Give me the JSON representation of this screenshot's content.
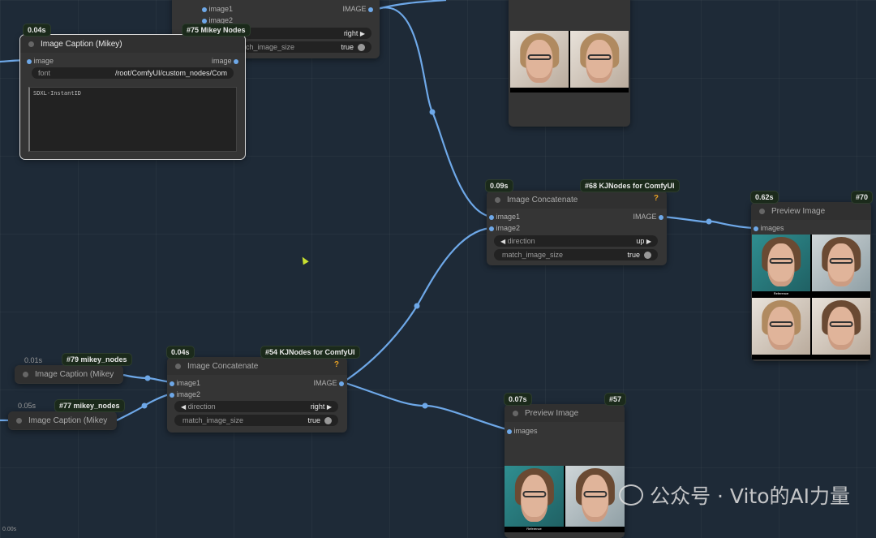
{
  "node_top": {
    "inputs": [
      "image1",
      "image2"
    ],
    "output": "IMAGE",
    "direction_value": "right",
    "match_label": "match_image_size",
    "match_value": "true"
  },
  "node_caption75": {
    "time": "0.04s",
    "badge": "#75 Mikey Nodes",
    "title": "Image Caption (Mikey)",
    "input": "image",
    "output": "image",
    "font_label": "font",
    "font_value": "/root/ComfyUI/custom_nodes/Com",
    "caption_text": "SDXL-InstantID"
  },
  "node_concat68": {
    "time": "0.09s",
    "badge": "#68 KJNodes for ComfyUI",
    "title": "Image Concatenate",
    "help": "?",
    "inputs": [
      "image1",
      "image2"
    ],
    "output": "IMAGE",
    "direction_label": "direction",
    "direction_value": "up",
    "match_label": "match_image_size",
    "match_value": "true"
  },
  "node_preview70": {
    "time": "0.62s",
    "badge": "#70",
    "title": "Preview Image",
    "input": "images",
    "captions": [
      "Reference",
      "",
      "",
      ""
    ]
  },
  "node_caption79": {
    "time": "0.01s",
    "badge": "#79 mikey_nodes",
    "title": "Image Caption (Mikey"
  },
  "node_caption77": {
    "time": "0.05s",
    "badge": "#77 mikey_nodes",
    "title": "Image Caption (Mikey"
  },
  "node_concat54": {
    "time": "0.04s",
    "badge": "#54 KJNodes for ComfyUI",
    "title": "Image Concatenate",
    "help": "?",
    "inputs": [
      "image1",
      "image2"
    ],
    "output": "IMAGE",
    "direction_label": "direction",
    "direction_value": "right",
    "match_label": "match_image_size",
    "match_value": "true"
  },
  "node_preview57": {
    "time": "0.07s",
    "badge": "#57",
    "title": "Preview Image",
    "input": "images",
    "captions": [
      "Reference",
      ""
    ]
  },
  "corner_time": "0.00s",
  "watermark": "公众号 · Vito的AI力量",
  "colors": {
    "canvas": "#1e2a37",
    "node": "#353535",
    "wire": "#6ea8e8",
    "badge": "#1b2a1b",
    "help": "#e5a024"
  },
  "icons": [
    "node-status-dot",
    "arrow-left-icon",
    "arrow-right-icon",
    "toggle-icon",
    "help-icon",
    "wechat-logo-icon",
    "mouse-cursor-icon"
  ]
}
